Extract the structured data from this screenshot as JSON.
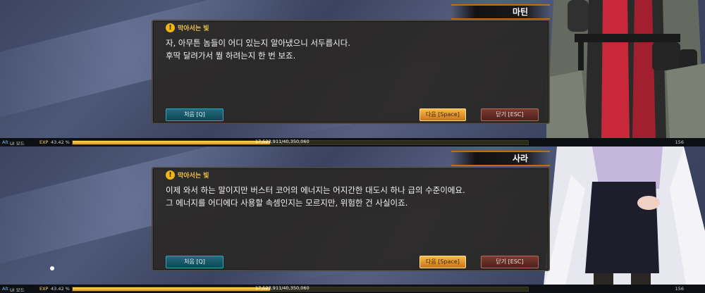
{
  "panels": [
    {
      "speaker": "마틴",
      "title": "막아서는 빛",
      "lines": [
        "자, 아무튼 놈들이 어디 있는지 알아냈으니 서두릅시다.",
        "후딱 달려가서 뭘 하려는지 한 번 보죠."
      ],
      "buttons": {
        "first": "처음 [Q]",
        "next": "다음 [Space]",
        "close": "닫기 [ESC]"
      },
      "status": {
        "alt": "Alt",
        "ui_mode": "UI 모드",
        "exp_label": "EXP",
        "exp_percent": "43.42 %",
        "exp_value": "17,523,911/40,350,060",
        "level": "156"
      },
      "exp_fraction": 0.4342
    },
    {
      "speaker": "사라",
      "title": "막아서는 빛",
      "lines": [
        "이제 와서 하는 말이지만 버스터 코어의 에너지는 어지간한 대도시 하나 급의 수준이에요.",
        "그 에너지를 어디에다 사용할 속셈인지는 모르지만, 위험한 건 사실이죠."
      ],
      "buttons": {
        "first": "처음 [Q]",
        "next": "다음 [Space]",
        "close": "닫기 [ESC]"
      },
      "status": {
        "alt": "Alt",
        "ui_mode": "UI 모드",
        "exp_label": "EXP",
        "exp_percent": "43.42 %",
        "exp_value": "17,523,911/40,350,060",
        "level": "156"
      },
      "exp_fraction": 0.4342
    }
  ],
  "colors": {
    "accent": "#f0c24a",
    "nametag_border": "#c46a12",
    "exp_fill": "#ffd75a"
  },
  "icons": {
    "title_icon": "warning-icon"
  }
}
